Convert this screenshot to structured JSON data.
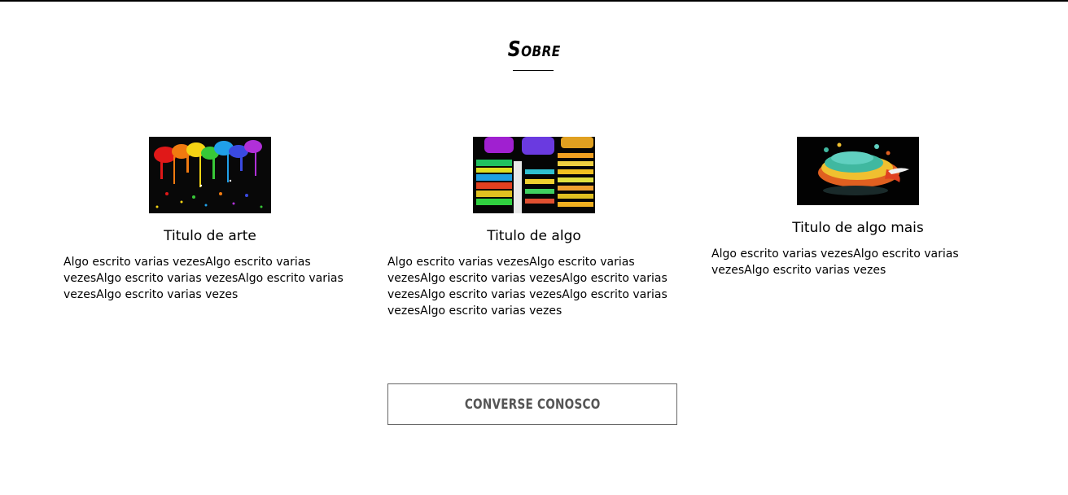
{
  "section": {
    "title": "Sobre"
  },
  "cards": [
    {
      "image": "paint-splatter-image",
      "title": "Titulo de arte",
      "text": "Algo escrito varias vezesAlgo escrito varias vezesAlgo escrito varias vezesAlgo escrito varias vezesAlgo escrito varias vezes"
    },
    {
      "image": "light-trails-image",
      "title": "Titulo de algo",
      "text": "Algo escrito varias vezesAlgo escrito varias vezesAlgo escrito varias vezesAlgo escrito varias vezesAlgo escrito varias vezesAlgo escrito varias vezesAlgo escrito varias vezes"
    },
    {
      "image": "paint-splash-cup-image",
      "title": "Titulo de algo mais",
      "text": "Algo escrito varias vezesAlgo escrito varias vezesAlgo escrito varias vezes"
    }
  ],
  "cta": {
    "label": "CONVERSE CONOSCO"
  }
}
